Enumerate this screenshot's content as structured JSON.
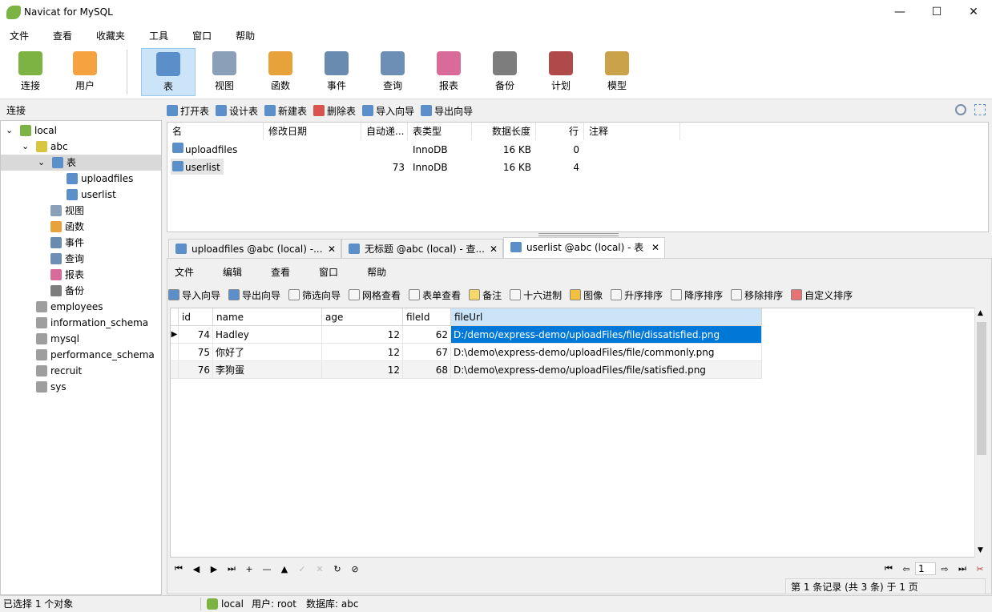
{
  "app": {
    "title": "Navicat for MySQL"
  },
  "window_controls": {
    "minimize": "—",
    "maximize": "☐",
    "close": "✕"
  },
  "menu": [
    "文件",
    "查看",
    "收藏夹",
    "工具",
    "窗口",
    "帮助"
  ],
  "toolbar": [
    {
      "label": "连接",
      "icon": "plug-icon",
      "color": "#7cb342"
    },
    {
      "label": "用户",
      "icon": "user-icon",
      "color": "#f4a340"
    },
    {
      "label": "表",
      "icon": "table-icon",
      "color": "#5b8fc9",
      "active": true
    },
    {
      "label": "视图",
      "icon": "view-icon",
      "color": "#8aa0b8"
    },
    {
      "label": "函数",
      "icon": "function-icon",
      "color": "#e7a23a"
    },
    {
      "label": "事件",
      "icon": "event-icon",
      "color": "#6a8bb0"
    },
    {
      "label": "查询",
      "icon": "query-icon",
      "color": "#6d8fb5"
    },
    {
      "label": "报表",
      "icon": "report-icon",
      "color": "#d96b9a"
    },
    {
      "label": "备份",
      "icon": "backup-icon",
      "color": "#7d7d7d"
    },
    {
      "label": "计划",
      "icon": "schedule-icon",
      "color": "#b04a4a"
    },
    {
      "label": "模型",
      "icon": "model-icon",
      "color": "#c9a24a"
    }
  ],
  "sidebar": {
    "header": "连接",
    "tree": [
      {
        "label": "local",
        "icon": "connection-icon",
        "color": "#7cb342"
      },
      {
        "label": "abc",
        "icon": "database-icon",
        "color": "#d8c640"
      },
      {
        "label": "表",
        "icon": "table-icon",
        "color": "#5b8fc9"
      },
      {
        "label": "uploadfiles",
        "icon": "table-icon",
        "color": "#5b8fc9"
      },
      {
        "label": "userlist",
        "icon": "table-icon",
        "color": "#5b8fc9"
      },
      {
        "label": "视图",
        "icon": "view-icon",
        "color": "#8aa0b8"
      },
      {
        "label": "函数",
        "icon": "function-icon",
        "color": "#e7a23a"
      },
      {
        "label": "事件",
        "icon": "event-icon",
        "color": "#6a8bb0"
      },
      {
        "label": "查询",
        "icon": "query-icon",
        "color": "#6d8fb5"
      },
      {
        "label": "报表",
        "icon": "report-icon",
        "color": "#d96b9a"
      },
      {
        "label": "备份",
        "icon": "backup-icon",
        "color": "#7d7d7d"
      },
      {
        "label": "employees",
        "icon": "database-icon",
        "color": "#9e9e9e"
      },
      {
        "label": "information_schema",
        "icon": "database-icon",
        "color": "#9e9e9e"
      },
      {
        "label": "mysql",
        "icon": "database-icon",
        "color": "#9e9e9e"
      },
      {
        "label": "performance_schema",
        "icon": "database-icon",
        "color": "#9e9e9e"
      },
      {
        "label": "recruit",
        "icon": "database-icon",
        "color": "#9e9e9e"
      },
      {
        "label": "sys",
        "icon": "database-icon",
        "color": "#9e9e9e"
      }
    ]
  },
  "object_toolbar": [
    "打开表",
    "设计表",
    "新建表",
    "删除表",
    "导入向导",
    "导出向导"
  ],
  "object_list": {
    "headers": [
      "名",
      "修改日期",
      "自动递...",
      "表类型",
      "数据长度",
      "行",
      "注释"
    ],
    "rows": [
      {
        "name": "uploadfiles",
        "modified": "",
        "auto_inc": "",
        "engine": "InnoDB",
        "data_length": "16 KB",
        "rows": "0",
        "comment": ""
      },
      {
        "name": "userlist",
        "modified": "",
        "auto_inc": "73",
        "engine": "InnoDB",
        "data_length": "16 KB",
        "rows": "4",
        "comment": ""
      }
    ]
  },
  "tabs": [
    {
      "label": "uploadfiles @abc (local) -...",
      "close": "✕"
    },
    {
      "label": "无标题 @abc (local) - 查...",
      "close": "✕"
    },
    {
      "label": "userlist @abc (local) - 表",
      "close": "✕"
    }
  ],
  "inner_menu": [
    "文件",
    "编辑",
    "查看",
    "窗口",
    "帮助"
  ],
  "inner_toolbar": [
    "导入向导",
    "导出向导",
    "筛选向导",
    "网格查看",
    "表单查看",
    "备注",
    "十六进制",
    "图像",
    "升序排序",
    "降序排序",
    "移除排序",
    "自定义排序"
  ],
  "grid": {
    "headers": [
      "id",
      "name",
      "age",
      "fileId",
      "fileUrl"
    ],
    "rows": [
      {
        "id": "74",
        "name": "Hadley",
        "age": "12",
        "fileId": "62",
        "fileUrl": "D:/demo/express-demo/uploadFiles/file/dissatisfied.png"
      },
      {
        "id": "75",
        "name": "你好了",
        "age": "12",
        "fileId": "67",
        "fileUrl": "D:\\demo\\express-demo/uploadFiles/file/commonly.png"
      },
      {
        "id": "76",
        "name": "李狗蛋",
        "age": "12",
        "fileId": "68",
        "fileUrl": "D:\\demo\\express-demo/uploadFiles/file/satisfied.png"
      }
    ]
  },
  "nav": {
    "buttons": [
      "⏮",
      "◀",
      "▶",
      "⏭",
      "+",
      "—",
      "▲",
      "✓",
      "✕",
      "↻",
      "⊘"
    ],
    "page": "1",
    "page_nav": [
      "⏮",
      "⇦",
      "⇨",
      "⏭"
    ]
  },
  "record_info": "第 1 条记录 (共 3 条) 于 1 页",
  "status": {
    "selection": "已选择 1 个对象",
    "connection": "local",
    "user": "用户: root",
    "database": "数据库: abc"
  }
}
